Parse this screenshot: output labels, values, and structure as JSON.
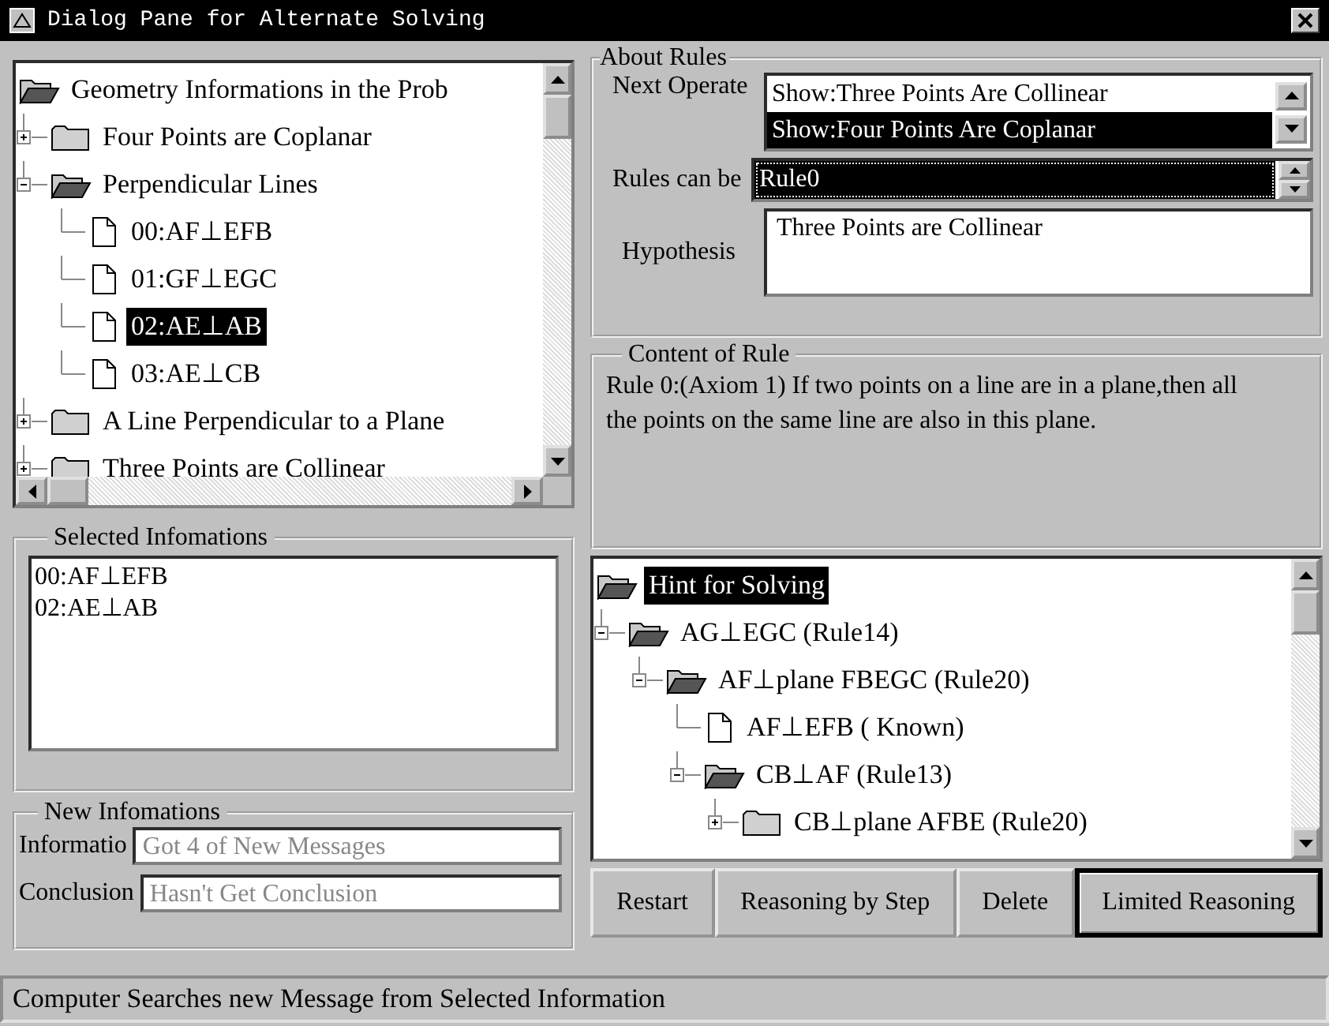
{
  "window": {
    "title": "Dialog Pane for Alternate Solving"
  },
  "geometry_tree": {
    "label": "Geometry Informations in the Prob",
    "kind": "folder",
    "expanded": true,
    "selected": false,
    "children": [
      {
        "label": "Four Points are Coplanar",
        "kind": "folder",
        "expanded": false,
        "selected": false
      },
      {
        "label": "Perpendicular Lines",
        "kind": "folder",
        "expanded": true,
        "selected": false,
        "children": [
          {
            "label": "00:AF⊥EFB",
            "kind": "document",
            "selected": false
          },
          {
            "label": "01:GF⊥EGC",
            "kind": "document",
            "selected": false
          },
          {
            "label": "02:AE⊥AB",
            "kind": "document",
            "selected": true
          },
          {
            "label": "03:AE⊥CB",
            "kind": "document",
            "selected": false
          }
        ]
      },
      {
        "label": "A Line Perpendicular to a Plane",
        "kind": "folder",
        "expanded": false,
        "selected": false
      },
      {
        "label": "Three Points are Collinear",
        "kind": "folder",
        "expanded": false,
        "selected": false
      }
    ]
  },
  "selected_informations": {
    "title": "Selected Infomations",
    "items": [
      "00:AF⊥EFB",
      "02:AE⊥AB"
    ]
  },
  "new_informations": {
    "title": "New Infomations",
    "fields": [
      {
        "label": "Informatio",
        "value": "Got 4 of New Messages",
        "disabled": true
      },
      {
        "label": "Conclusion",
        "value": "Hasn't Get Conclusion",
        "disabled": true
      }
    ]
  },
  "about_rules": {
    "title": "About Rules",
    "next_operate": {
      "label": "Next Operate",
      "options": [
        {
          "label": "Show:Three Points Are Collinear",
          "selected": false
        },
        {
          "label": "Show:Four Points Are Coplanar",
          "selected": true
        }
      ]
    },
    "rules_can_be": {
      "label": "Rules can be",
      "value": "Rule0",
      "selected": true
    },
    "hypothesis": {
      "label": "Hypothesis",
      "value": "Three Points are Collinear"
    }
  },
  "content_of_rule": {
    "title": "Content of Rule",
    "text": "Rule 0:(Axiom 1) If two points on a line are in a plane,then all the points on the same line are also in this plane."
  },
  "hint_tree": {
    "label": "Hint for Solving",
    "kind": "folder",
    "expanded": true,
    "selected": true,
    "children": [
      {
        "label": "AG⊥EGC (Rule14)",
        "kind": "folder",
        "expanded": true,
        "selected": false,
        "children": [
          {
            "label": "AF⊥plane FBEGC (Rule20)",
            "kind": "folder",
            "expanded": true,
            "selected": false,
            "children": [
              {
                "label": "AF⊥EFB ( Known)",
                "kind": "document",
                "selected": false
              },
              {
                "label": "CB⊥AF (Rule13)",
                "kind": "folder",
                "expanded": true,
                "selected": false,
                "children": [
                  {
                    "label": "CB⊥plane AFBE (Rule20)",
                    "kind": "folder",
                    "expanded": false,
                    "selected": false
                  }
                ]
              }
            ]
          }
        ]
      }
    ]
  },
  "buttons": [
    {
      "label": "Restart",
      "default": false
    },
    {
      "label": "Reasoning by Step",
      "default": false
    },
    {
      "label": "Delete",
      "default": false
    },
    {
      "label": "Limited Reasoning",
      "default": true
    }
  ],
  "status_bar": {
    "text": "Computer Searches new Message from Selected Information"
  }
}
